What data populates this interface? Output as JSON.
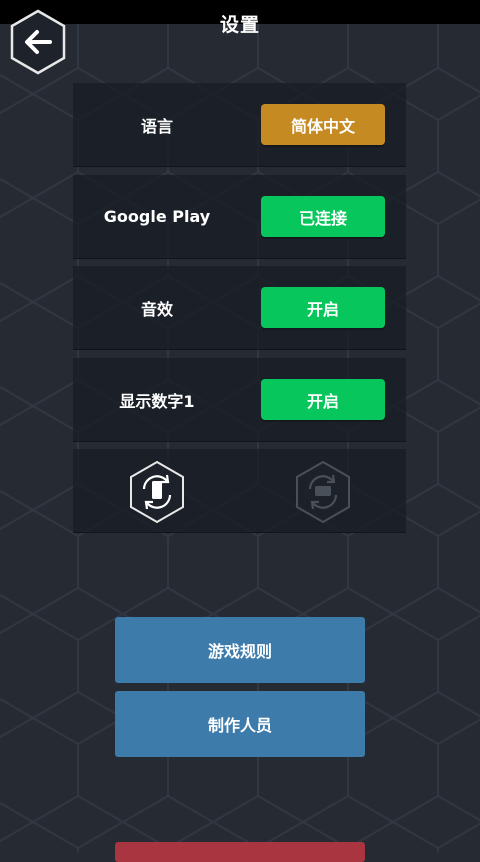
{
  "header": {
    "title": "设置"
  },
  "settings": [
    {
      "label": "语言",
      "value": "简体中文",
      "color": "#c68a22"
    },
    {
      "label": "Google Play",
      "value": "已连接",
      "color": "#07c65c"
    },
    {
      "label": "音效",
      "value": "开启",
      "color": "#07c65c"
    },
    {
      "label": "显示数字1",
      "value": "开启",
      "color": "#07c65c"
    }
  ],
  "orientation": {
    "portrait_icon": "rotate-portrait-icon",
    "landscape_icon": "rotate-landscape-icon",
    "selected": "portrait"
  },
  "actions": {
    "rules_label": "游戏规则",
    "credits_label": "制作人员"
  },
  "colors": {
    "background": "#262b33",
    "row": "#1c2027",
    "accent_orange": "#c68a22",
    "accent_green": "#07c65c",
    "accent_blue": "#3d7bab",
    "accent_red": "#a8353f"
  }
}
